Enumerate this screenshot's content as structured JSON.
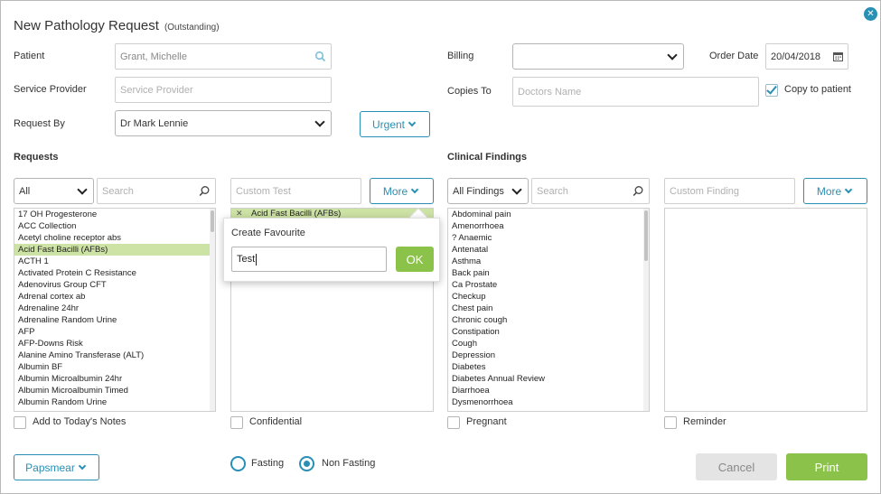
{
  "dialog": {
    "title": "New Pathology Request",
    "status": "(Outstanding)",
    "close_glyph": "✕"
  },
  "form": {
    "patient_label": "Patient",
    "patient_value": "Grant, Michelle",
    "service_provider_label": "Service Provider",
    "service_provider_placeholder": "Service Provider",
    "request_by_label": "Request By",
    "request_by_value": "Dr Mark Lennie",
    "urgent_label": "Urgent",
    "billing_label": "Billing",
    "billing_value": "",
    "copies_to_label": "Copies To",
    "copies_to_placeholder": "Doctors Name",
    "order_date_label": "Order Date",
    "order_date_value": "20/04/2018",
    "copy_to_patient_label": "Copy to patient",
    "copy_to_patient_checked": true
  },
  "requests": {
    "section_title": "Requests",
    "filter_value": "All",
    "search_placeholder": "Search",
    "custom_test_placeholder": "Custom Test",
    "more_label": "More",
    "items": [
      "17 OH Progesterone",
      "ACC Collection",
      "Acetyl choline receptor abs",
      "Acid Fast Bacilli (AFBs)",
      "ACTH 1",
      "Activated Protein C Resistance",
      "Adenovirus Group CFT",
      "Adrenal cortex ab",
      "Adrenaline 24hr",
      "Adrenaline Random Urine",
      "AFP",
      "AFP-Downs Risk",
      "Alanine Amino Transferase (ALT)",
      "Albumin BF",
      "Albumin Microalbumin 24hr",
      "Albumin Microalbumin Timed",
      "Albumin Random Urine"
    ],
    "selected_index": 3,
    "selected_chip": "Acid Fast Bacilli (AFBs)",
    "add_to_notes_label": "Add to Today's Notes",
    "confidential_label": "Confidential"
  },
  "favourite_popup": {
    "title": "Create Favourite",
    "input_value": "Test",
    "ok_label": "OK"
  },
  "clinical": {
    "section_title": "Clinical Findings",
    "filter_value": "All Findings",
    "search_placeholder": "Search",
    "custom_finding_placeholder": "Custom Finding",
    "more_label": "More",
    "items": [
      "Abdominal pain",
      "Amenorrhoea",
      "? Anaemic",
      "Antenatal",
      "Asthma",
      "Back pain",
      "Ca Prostate",
      "Checkup",
      "Chest pain",
      "Chronic cough",
      "Constipation",
      "Cough",
      "Depression",
      "Diabetes",
      "Diabetes Annual Review",
      "Diarrhoea",
      "Dysmenorrhoea"
    ],
    "pregnant_label": "Pregnant",
    "reminder_label": "Reminder"
  },
  "footer": {
    "papsmear_label": "Papsmear",
    "fasting_label": "Fasting",
    "non_fasting_label": "Non Fasting",
    "fasting_selected": "non_fasting",
    "cancel_label": "Cancel",
    "print_label": "Print"
  },
  "colors": {
    "accent": "#2a8fb5",
    "green": "#8bc34a",
    "selection": "#cde2a5"
  }
}
